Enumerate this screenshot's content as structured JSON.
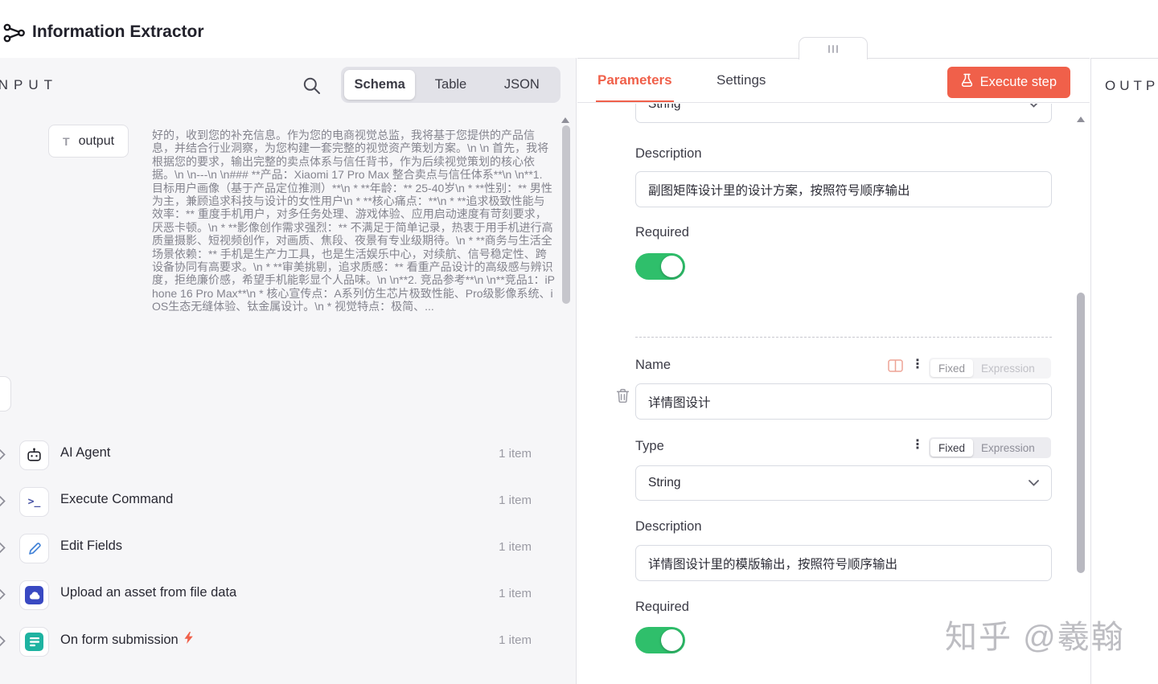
{
  "header": {
    "title": "Information Extractor"
  },
  "input_panel": {
    "label": "INPUT",
    "tabs": {
      "schema": "Schema",
      "table": "Table",
      "json": "JSON"
    },
    "schema_field": {
      "type_icon": "T",
      "key": "output",
      "value": "好的，收到您的补充信息。作为您的电商视觉总监，我将基于您提供的产品信息，并结合行业洞察，为您构建一套完整的视觉资产策划方案。\\n \\n 首先，我将根据您的要求，输出完整的卖点体系与信任背书，作为后续视觉策划的核心依据。\\n \\n---\\n \\n### **产品：Xiaomi 17 Pro Max 整合卖点与信任体系**\\n \\n**1. 目标用户画像（基于产品定位推测）**\\n * **年龄：** 25-40岁\\n * **性别：** 男性为主，兼顾追求科技与设计的女性用户\\n * **核心痛点：**\\n * **追求极致性能与效率：** 重度手机用户，对多任务处理、游戏体验、应用启动速度有苛刻要求，厌恶卡顿。\\n * **影像创作需求强烈：** 不满足于简单记录，热衷于用手机进行高质量摄影、短视频创作，对画质、焦段、夜景有专业级期待。\\n * **商务与生活全场景依赖：** 手机是生产力工具，也是生活娱乐中心，对续航、信号稳定性、跨设备协同有高要求。\\n * **审美挑剔，追求质感：** 看重产品设计的高级感与辨识度，拒绝廉价感，希望手机能彰显个人品味。\\n \\n**2. 竞品参考**\\n \\n**竞品1：iPhone 16 Pro Max**\\n * 核心宣传点：A系列仿生芯片极致性能、Pro级影像系统、iOS生态无缝体验、钛金属设计。\\n * 视觉特点：极简、..."
    },
    "nodes": [
      {
        "name": "AI Agent",
        "count": "1 item"
      },
      {
        "name": "Execute Command",
        "count": "1 item"
      },
      {
        "name": "Edit Fields",
        "count": "1 item"
      },
      {
        "name": "Upload an asset from file data",
        "count": "1 item"
      },
      {
        "name": "On form submission",
        "count": "1 item"
      }
    ]
  },
  "params_panel": {
    "tabs": {
      "parameters": "Parameters",
      "settings": "Settings"
    },
    "execute_button": "Execute step",
    "top_partial_select": "String",
    "segment": {
      "fixed": "Fixed",
      "expression": "Expression"
    },
    "attr1": {
      "description_label": "Description",
      "description_value": "副图矩阵设计里的设计方案，按照符号顺序输出",
      "required_label": "Required"
    },
    "attr2": {
      "name_label": "Name",
      "name_value": "详情图设计",
      "type_label": "Type",
      "type_value": "String",
      "description_label": "Description",
      "description_value": "详情图设计里的模版输出，按照符号顺序输出",
      "required_label": "Required"
    }
  },
  "output_panel": {
    "label": "OUTPUT"
  },
  "watermark": "知乎 @羲翰",
  "colors": {
    "accent": "#f0604a",
    "toggle_on": "#2fbf6b"
  }
}
